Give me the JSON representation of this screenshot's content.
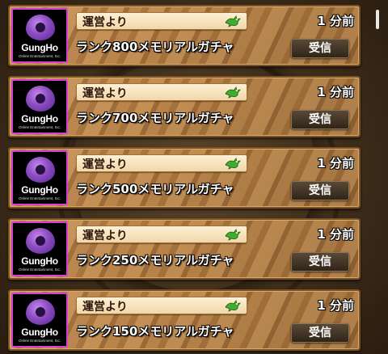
{
  "messages": [
    {
      "logo_text": "GungHo",
      "logo_sub": "Online Entertainment, Inc.",
      "sender": "運営より",
      "time": "1 分前",
      "subject": "ランク800メモリアルガチャ",
      "action": "受信",
      "icon": "green-dragon-icon"
    },
    {
      "logo_text": "GungHo",
      "logo_sub": "Online Entertainment, Inc.",
      "sender": "運営より",
      "time": "1 分前",
      "subject": "ランク700メモリアルガチャ",
      "action": "受信",
      "icon": "green-dragon-icon"
    },
    {
      "logo_text": "GungHo",
      "logo_sub": "Online Entertainment, Inc.",
      "sender": "運営より",
      "time": "1 分前",
      "subject": "ランク500メモリアルガチャ",
      "action": "受信",
      "icon": "green-dragon-icon"
    },
    {
      "logo_text": "GungHo",
      "logo_sub": "Online Entertainment, Inc.",
      "sender": "運営より",
      "time": "1 分前",
      "subject": "ランク250メモリアルガチャ",
      "action": "受信",
      "icon": "green-dragon-icon"
    },
    {
      "logo_text": "GungHo",
      "logo_sub": "Online Entertainment, Inc.",
      "sender": "運営より",
      "time": "1 分前",
      "subject": "ランク150メモリアルガチャ",
      "action": "受信",
      "icon": "green-dragon-icon"
    }
  ],
  "colors": {
    "logo_border": "#d63fd6",
    "logo_purple": "#8b4cc0",
    "card_wood": "#b9844a",
    "dragon_green": "#3fae2f"
  }
}
